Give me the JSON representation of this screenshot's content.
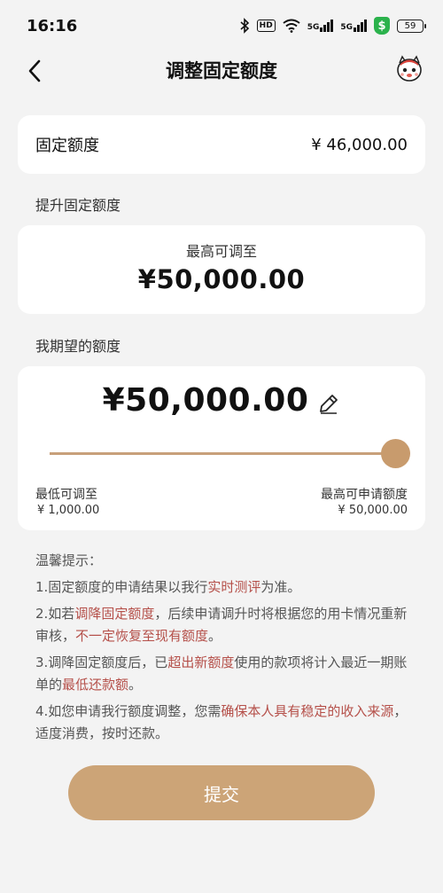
{
  "status_bar": {
    "time": "16:16",
    "hd_label": "HD",
    "sim1_label": "5G",
    "sim2_label": "5G",
    "battery_level": "59"
  },
  "nav": {
    "title": "调整固定额度"
  },
  "fixed_limit": {
    "label": "固定额度",
    "value": "¥ 46,000.00"
  },
  "raise_section": {
    "label": "提升固定额度",
    "max_caption": "最高可调至",
    "max_value": "¥50,000.00"
  },
  "expect_section": {
    "label": "我期望的额度",
    "value": "¥50,000.00",
    "slider_fraction": 1.0,
    "min_label": "最低可调至",
    "min_value": "¥ 1,000.00",
    "max_label": "最高可申请额度",
    "max_value": "¥ 50,000.00"
  },
  "tips": {
    "title": "温馨提示：",
    "items": [
      {
        "parts": [
          {
            "t": "1.固定额度的申请结果以我行"
          },
          {
            "t": "实时测评",
            "hl": true
          },
          {
            "t": "为准。"
          }
        ]
      },
      {
        "parts": [
          {
            "t": "2.如若"
          },
          {
            "t": "调降固定额度",
            "hl": true
          },
          {
            "t": "，后续申请调升时将根据您的用卡情况重新审核，"
          },
          {
            "t": "不一定恢复至现有额度",
            "hl": true
          },
          {
            "t": "。"
          }
        ]
      },
      {
        "parts": [
          {
            "t": "3.调降固定额度后，已"
          },
          {
            "t": "超出新额度",
            "hl": true
          },
          {
            "t": "使用的款项将计入最近一期账单的"
          },
          {
            "t": "最低还款额",
            "hl": true
          },
          {
            "t": "。"
          }
        ]
      },
      {
        "parts": [
          {
            "t": "4.如您申请我行额度调整，您需"
          },
          {
            "t": "确保本人具有稳定的收入来源",
            "hl": true
          },
          {
            "t": "，适度消费，按时还款。"
          }
        ]
      }
    ]
  },
  "submit": {
    "label": "提交"
  },
  "colors": {
    "accent": "#cca477",
    "highlight": "#b5504a",
    "background": "#f3f3f3"
  },
  "icons": [
    "bluetooth-icon",
    "wifi-icon",
    "signal-icon",
    "money-badge-icon",
    "battery-icon",
    "back-arrow-icon",
    "mascot-icon",
    "edit-pencil-icon"
  ]
}
